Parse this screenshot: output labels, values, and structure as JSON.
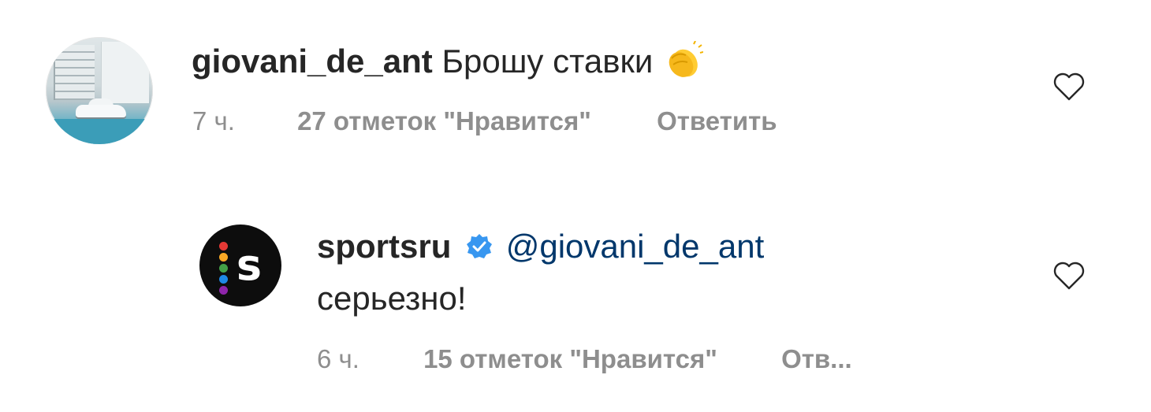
{
  "comments": [
    {
      "username": "giovani_de_ant",
      "text": "Брошу ставки",
      "emoji": "clapping-hands-emoji",
      "time": "7 ч.",
      "likes": "27 отметок \"Нравится\"",
      "reply": "Ответить"
    },
    {
      "username": "sportsru",
      "verified": true,
      "mention": "@giovani_de_ant",
      "text": "серьезно!",
      "time": "6 ч.",
      "likes": "15 отметок \"Нравится\"",
      "reply": "Отв..."
    }
  ],
  "colors": {
    "text": "#262626",
    "meta": "#8e8e8e",
    "mention": "#00376b",
    "verified": "#3897f0",
    "logo_bg": "#0d0d0d",
    "logo_dots": [
      "#e53935",
      "#f9a825",
      "#43a047",
      "#1e88e5",
      "#8e24aa"
    ]
  },
  "icons": {
    "like": "heart-outline-icon",
    "verified": "verified-badge-icon"
  }
}
